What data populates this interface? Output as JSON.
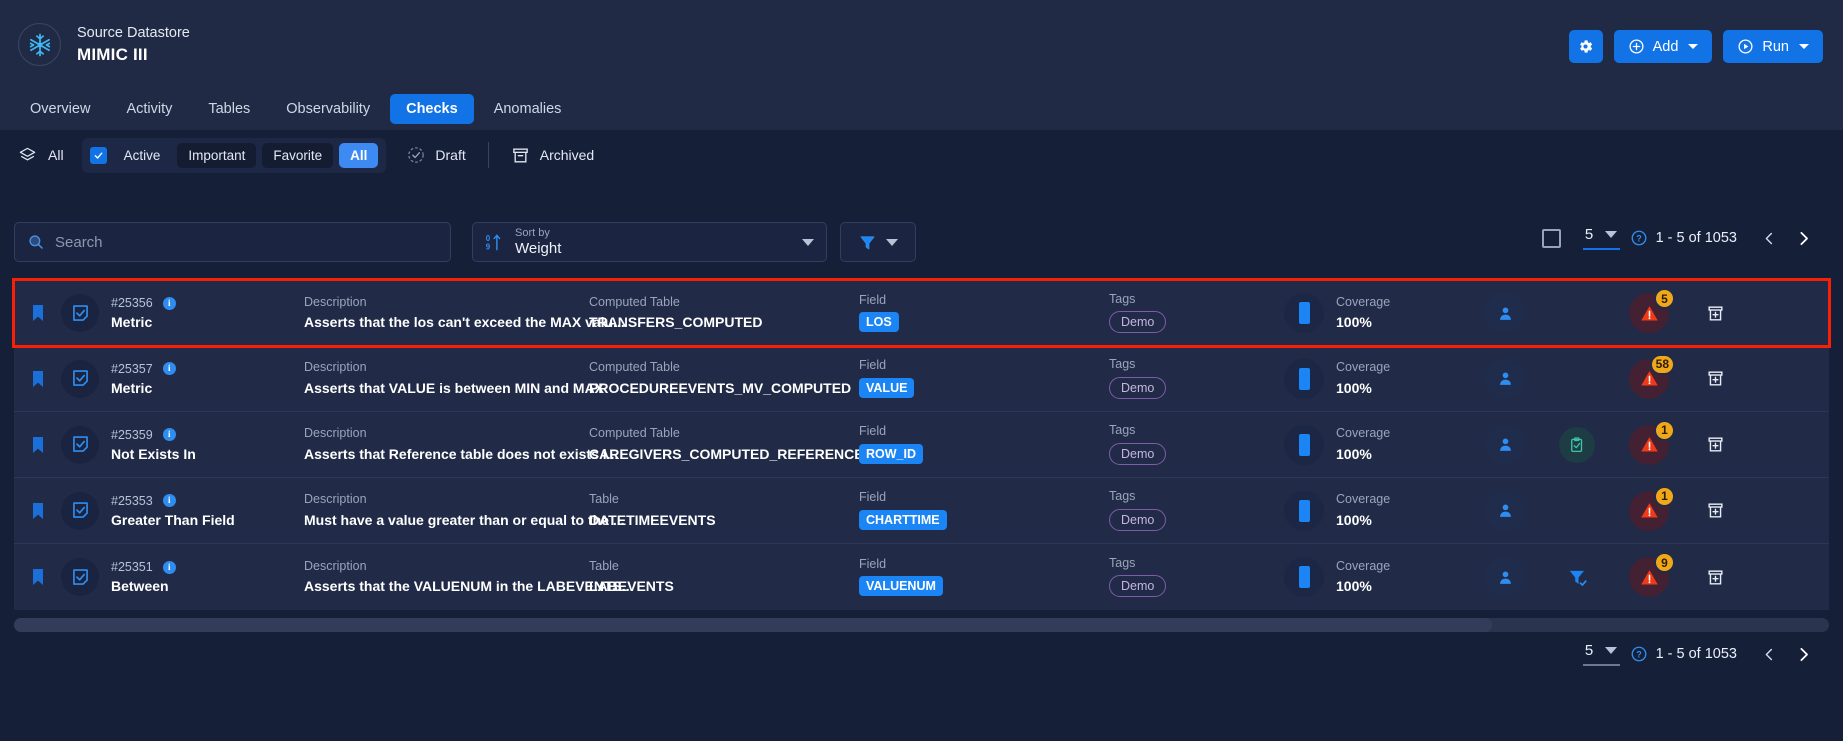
{
  "header": {
    "datastore_label": "Source Datastore",
    "datastore_name": "MIMIC III",
    "settings_icon": "gear-icon",
    "add_label": "Add",
    "run_label": "Run"
  },
  "nav": {
    "tabs": [
      {
        "label": "Overview",
        "active": false
      },
      {
        "label": "Activity",
        "active": false
      },
      {
        "label": "Tables",
        "active": false
      },
      {
        "label": "Observability",
        "active": false
      },
      {
        "label": "Checks",
        "active": true
      },
      {
        "label": "Anomalies",
        "active": false
      }
    ]
  },
  "filters": {
    "all_label": "All",
    "active_label": "Active",
    "important_label": "Important",
    "favorite_label": "Favorite",
    "all_chip_label": "All",
    "draft_label": "Draft",
    "archived_label": "Archived"
  },
  "search": {
    "placeholder": "Search",
    "value": ""
  },
  "sort": {
    "label": "Sort by",
    "value": "Weight"
  },
  "pagination": {
    "page_size": "5",
    "range": "1 - 5 of 1053"
  },
  "table": {
    "labels": {
      "description": "Description",
      "computed_table": "Computed Table",
      "table": "Table",
      "field": "Field",
      "tags": "Tags",
      "coverage": "Coverage"
    },
    "rows": [
      {
        "id": "#25356",
        "type": "Metric",
        "description": "Asserts that the los can't exceed the MAX valu...",
        "table_label": "Computed Table",
        "table_value": "TRANSFERS_COMPUTED",
        "field": "LOS",
        "tag": "Demo",
        "coverage": "100%",
        "alert_count": "5",
        "extra_icon": "none",
        "highlighted": true
      },
      {
        "id": "#25357",
        "type": "Metric",
        "description": "Asserts that VALUE is between MIN and MAX",
        "table_label": "Computed Table",
        "table_value": "PROCEDUREEVENTS_MV_COMPUTED",
        "field": "VALUE",
        "tag": "Demo",
        "coverage": "100%",
        "alert_count": "58",
        "extra_icon": "none",
        "highlighted": false
      },
      {
        "id": "#25359",
        "type": "Not Exists In",
        "description": "Asserts that Reference table does not exists i...",
        "table_label": "Computed Table",
        "table_value": "CAREGIVERS_COMPUTED_REFERENCE",
        "field": "ROW_ID",
        "tag": "Demo",
        "coverage": "100%",
        "alert_count": "1",
        "extra_icon": "clipboard-check-icon",
        "highlighted": false
      },
      {
        "id": "#25353",
        "type": "Greater Than Field",
        "description": "Must have a value greater than or equal to the ...",
        "table_label": "Table",
        "table_value": "DATETIMEEVENTS",
        "field": "CHARTTIME",
        "tag": "Demo",
        "coverage": "100%",
        "alert_count": "1",
        "extra_icon": "none",
        "highlighted": false
      },
      {
        "id": "#25351",
        "type": "Between",
        "description": "Asserts that the VALUENUM in the LABEVENTS...",
        "table_label": "Table",
        "table_value": "LABEVENTS",
        "field": "VALUENUM",
        "tag": "Demo",
        "coverage": "100%",
        "alert_count": "9",
        "extra_icon": "filter-check-icon",
        "highlighted": false
      }
    ]
  },
  "colors": {
    "accent": "#1173e6",
    "page_bg": "#161f38",
    "header_bg": "#202a44",
    "row_bg": "#212b47",
    "highlight": "#f81f07",
    "warning": "#f0a81a",
    "alert": "#f03a17"
  }
}
